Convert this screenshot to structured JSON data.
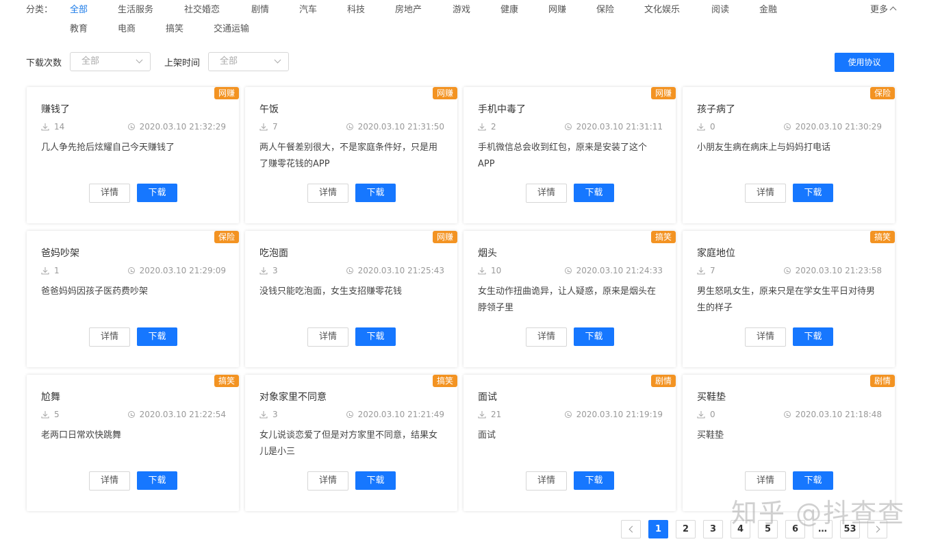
{
  "category_filter": {
    "label": "分类：",
    "items": [
      "全部",
      "生活服务",
      "社交婚恋",
      "剧情",
      "汽车",
      "科技",
      "房地产",
      "游戏",
      "健康",
      "网赚",
      "保险",
      "文化娱乐",
      "阅读",
      "金融",
      "教育",
      "电商",
      "搞笑",
      "交通运输"
    ],
    "active": "全部",
    "more_label": "更多"
  },
  "filters": {
    "downloads_label": "下载次数",
    "downloads_value": "全部",
    "listing_time_label": "上架时间",
    "listing_time_value": "全部",
    "agreement_button": "使用协议"
  },
  "cards": [
    {
      "tag": "网赚",
      "title": "赚钱了",
      "downloads": "14",
      "time": "2020.03.10 21:32:29",
      "desc": "几人争先抢后炫耀自己今天赚钱了"
    },
    {
      "tag": "网赚",
      "title": "午饭",
      "downloads": "7",
      "time": "2020.03.10 21:31:50",
      "desc": "两人午餐差别很大，不是家庭条件好，只是用了赚零花钱的APP"
    },
    {
      "tag": "网赚",
      "title": "手机中毒了",
      "downloads": "2",
      "time": "2020.03.10 21:31:11",
      "desc": "手机微信总会收到红包，原来是安装了这个APP"
    },
    {
      "tag": "保险",
      "title": "孩子病了",
      "downloads": "0",
      "time": "2020.03.10 21:30:29",
      "desc": "小朋友生病在病床上与妈妈打电话"
    },
    {
      "tag": "保险",
      "title": "爸妈吵架",
      "downloads": "1",
      "time": "2020.03.10 21:29:09",
      "desc": "爸爸妈妈因孩子医药费吵架"
    },
    {
      "tag": "网赚",
      "title": "吃泡面",
      "downloads": "3",
      "time": "2020.03.10 21:25:43",
      "desc": "没钱只能吃泡面，女生支招赚零花钱"
    },
    {
      "tag": "搞笑",
      "title": "烟头",
      "downloads": "10",
      "time": "2020.03.10 21:24:33",
      "desc": "女生动作扭曲诡异，让人疑惑，原来是烟头在脖领子里"
    },
    {
      "tag": "搞笑",
      "title": "家庭地位",
      "downloads": "7",
      "time": "2020.03.10 21:23:58",
      "desc": "男生怒吼女生，原来只是在学女生平日对待男生的样子"
    },
    {
      "tag": "搞笑",
      "title": "尬舞",
      "downloads": "5",
      "time": "2020.03.10 21:22:54",
      "desc": "老两口日常欢快跳舞"
    },
    {
      "tag": "搞笑",
      "title": "对象家里不同意",
      "downloads": "3",
      "time": "2020.03.10 21:21:49",
      "desc": "女儿说谈恋爱了但是对方家里不同意，结果女儿是小三"
    },
    {
      "tag": "剧情",
      "title": "面试",
      "downloads": "21",
      "time": "2020.03.10 21:19:19",
      "desc": "面试"
    },
    {
      "tag": "剧情",
      "title": "买鞋垫",
      "downloads": "0",
      "time": "2020.03.10 21:18:48",
      "desc": "买鞋垫"
    }
  ],
  "card_buttons": {
    "detail": "详情",
    "download": "下载"
  },
  "pagination": {
    "pages": [
      "1",
      "2",
      "3",
      "4",
      "5",
      "6",
      "…",
      "53"
    ],
    "current": "1"
  },
  "watermark": "知乎 @抖查查",
  "colors": {
    "primary": "#1677ff",
    "tag": "#f39322",
    "active_text": "#1a7ae8"
  }
}
